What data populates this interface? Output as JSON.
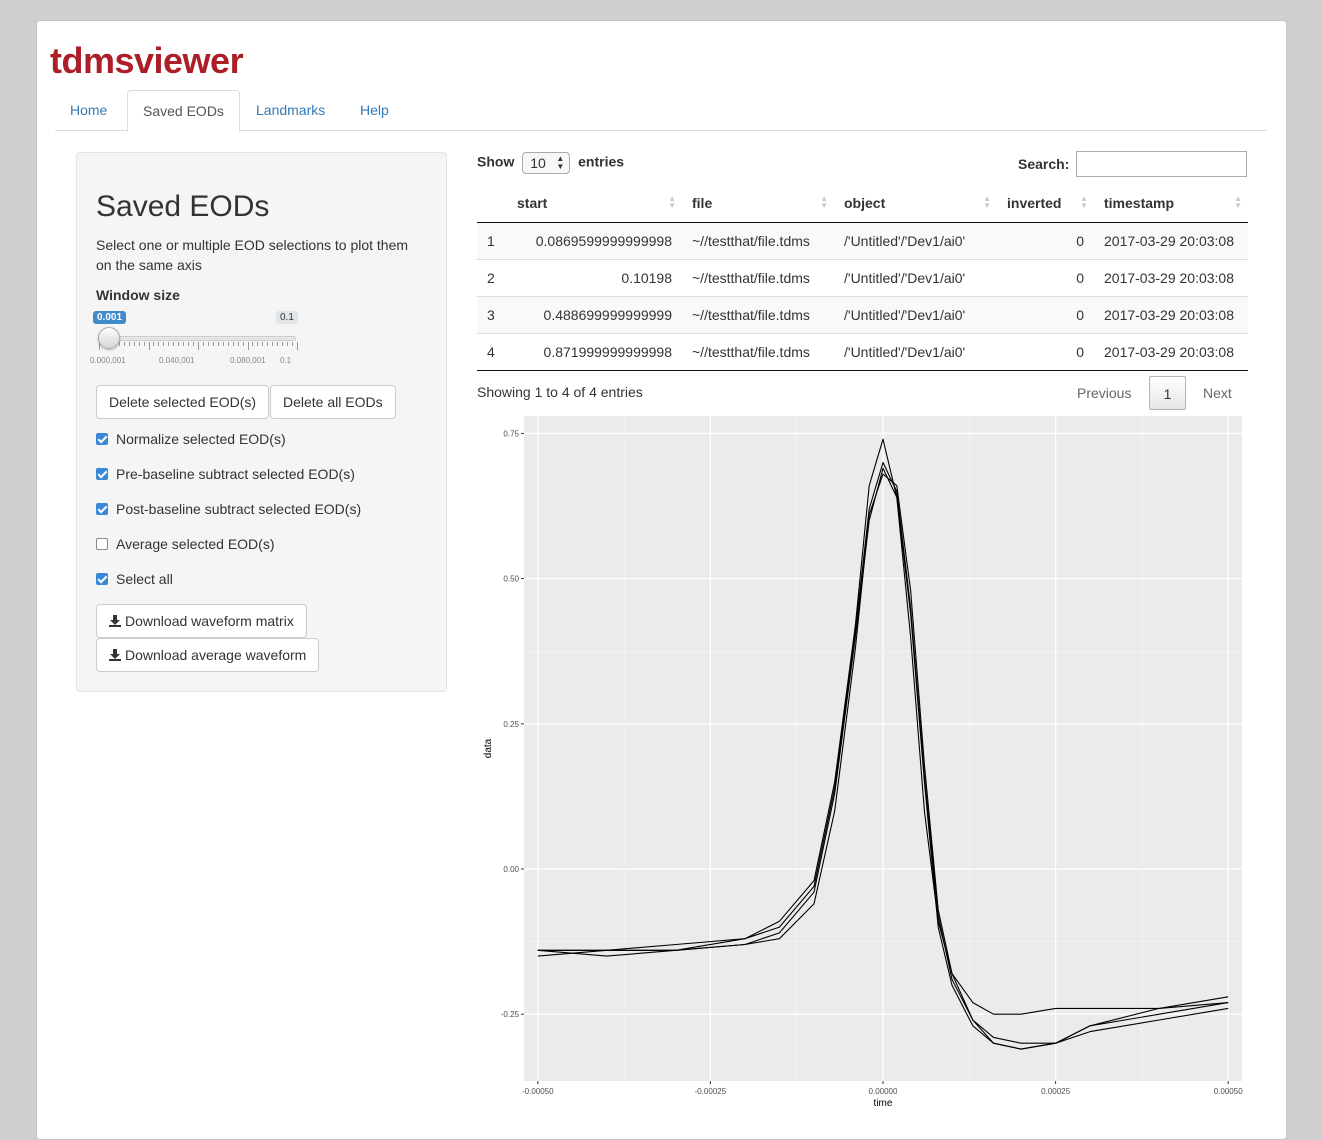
{
  "app": {
    "title": "tdmsviewer"
  },
  "tabs": [
    {
      "label": "Home",
      "active": false
    },
    {
      "label": "Saved EODs",
      "active": true
    },
    {
      "label": "Landmarks",
      "active": false
    },
    {
      "label": "Help",
      "active": false
    }
  ],
  "sidebar": {
    "heading": "Saved EODs",
    "description": "Select one or multiple EOD selections to plot them on the same axis",
    "window_size": {
      "label": "Window size",
      "from": "0.001",
      "to": "0.1",
      "ticks": [
        "0.000,001",
        "0.040,001",
        "0.080,001",
        "0.1"
      ]
    },
    "buttons": {
      "delete_selected": "Delete selected EOD(s)",
      "delete_all": "Delete all EODs"
    },
    "checkboxes": [
      {
        "label": "Normalize selected EOD(s)",
        "checked": true
      },
      {
        "label": "Pre-baseline subtract selected EOD(s)",
        "checked": true
      },
      {
        "label": "Post-baseline subtract selected EOD(s)",
        "checked": true
      },
      {
        "label": "Average selected EOD(s)",
        "checked": false
      },
      {
        "label": "Select all",
        "checked": true
      }
    ],
    "downloads": {
      "matrix": "Download waveform matrix",
      "average": "Download average waveform"
    }
  },
  "table": {
    "show_label": "Show",
    "page_length": "10",
    "entries_label": "entries",
    "search_label": "Search:",
    "search_value": "",
    "columns": [
      "",
      "start",
      "file",
      "object",
      "inverted",
      "timestamp"
    ],
    "rows": [
      [
        "1",
        "0.0869599999999998",
        "~//testthat/file.tdms",
        "/'Untitled'/'Dev1/ai0'",
        "0",
        "2017-03-29 20:03:08"
      ],
      [
        "2",
        "0.10198",
        "~//testthat/file.tdms",
        "/'Untitled'/'Dev1/ai0'",
        "0",
        "2017-03-29 20:03:08"
      ],
      [
        "3",
        "0.488699999999999",
        "~//testthat/file.tdms",
        "/'Untitled'/'Dev1/ai0'",
        "0",
        "2017-03-29 20:03:08"
      ],
      [
        "4",
        "0.871999999999998",
        "~//testthat/file.tdms",
        "/'Untitled'/'Dev1/ai0'",
        "0",
        "2017-03-29 20:03:08"
      ]
    ],
    "info": "Showing 1 to 4 of 4 entries",
    "pagination": {
      "previous": "Previous",
      "current": "1",
      "next": "Next"
    }
  },
  "chart_data": {
    "type": "line",
    "xlabel": "time",
    "ylabel": "data",
    "xlim": [
      -0.00052,
      0.00052
    ],
    "ylim": [
      -0.365,
      0.78
    ],
    "xticks": [
      -0.0005,
      -0.00025,
      0,
      0.00025,
      0.0005
    ],
    "xtick_labels": [
      "-0.00050",
      "-0.00025",
      "0.00000",
      "0.00025",
      "0.00050"
    ],
    "yticks": [
      -0.25,
      0,
      0.25,
      0.5,
      0.75
    ],
    "ytick_labels": [
      "-0.25",
      "0.00",
      "0.25",
      "0.50",
      "0.75"
    ],
    "grid": true,
    "background": "#ebebeb",
    "line_color": "#000000",
    "series": [
      {
        "x": [
          -0.0005,
          -0.0004,
          -0.0003,
          -0.0002,
          -0.00015,
          -0.0001,
          -7e-05,
          -4e-05,
          -2e-05,
          0,
          2e-05,
          4e-05,
          6e-05,
          8e-05,
          0.0001,
          0.00013,
          0.00016,
          0.0002,
          0.00025,
          0.0003,
          0.0004,
          0.0005
        ],
        "y": [
          -0.14,
          -0.14,
          -0.13,
          -0.12,
          -0.09,
          -0.02,
          0.15,
          0.42,
          0.66,
          0.74,
          0.64,
          0.4,
          0.1,
          -0.09,
          -0.18,
          -0.23,
          -0.25,
          -0.25,
          -0.24,
          -0.24,
          -0.24,
          -0.22
        ]
      },
      {
        "x": [
          -0.0005,
          -0.0004,
          -0.0003,
          -0.0002,
          -0.00015,
          -0.0001,
          -7e-05,
          -4e-05,
          -2e-05,
          0,
          2e-05,
          4e-05,
          6e-05,
          8e-05,
          0.0001,
          0.00013,
          0.00016,
          0.0002,
          0.00025,
          0.0003,
          0.0004,
          0.0005
        ],
        "y": [
          -0.15,
          -0.14,
          -0.14,
          -0.13,
          -0.11,
          -0.04,
          0.13,
          0.4,
          0.6,
          0.69,
          0.64,
          0.44,
          0.15,
          -0.1,
          -0.2,
          -0.27,
          -0.3,
          -0.31,
          -0.3,
          -0.28,
          -0.26,
          -0.24
        ]
      },
      {
        "x": [
          -0.0005,
          -0.0004,
          -0.0003,
          -0.0002,
          -0.00015,
          -0.0001,
          -7e-05,
          -4e-05,
          -2e-05,
          0,
          2e-05,
          4e-05,
          6e-05,
          8e-05,
          0.0001,
          0.00013,
          0.00016,
          0.0002,
          0.00025,
          0.0003,
          0.0004,
          0.0005
        ],
        "y": [
          -0.14,
          -0.15,
          -0.14,
          -0.12,
          -0.1,
          -0.03,
          0.14,
          0.41,
          0.62,
          0.7,
          0.65,
          0.45,
          0.16,
          -0.08,
          -0.19,
          -0.26,
          -0.29,
          -0.3,
          -0.3,
          -0.27,
          -0.25,
          -0.23
        ]
      },
      {
        "x": [
          -0.0005,
          -0.0004,
          -0.0003,
          -0.0002,
          -0.00015,
          -0.0001,
          -7e-05,
          -4e-05,
          -2e-05,
          0,
          2e-05,
          4e-05,
          6e-05,
          8e-05,
          0.0001,
          0.00013,
          0.00016,
          0.0002,
          0.00025,
          0.0003,
          0.0004,
          0.0005
        ],
        "y": [
          -0.14,
          -0.14,
          -0.14,
          -0.13,
          -0.12,
          -0.06,
          0.1,
          0.38,
          0.61,
          0.68,
          0.66,
          0.48,
          0.18,
          -0.07,
          -0.18,
          -0.26,
          -0.3,
          -0.31,
          -0.3,
          -0.27,
          -0.24,
          -0.23
        ]
      }
    ]
  }
}
